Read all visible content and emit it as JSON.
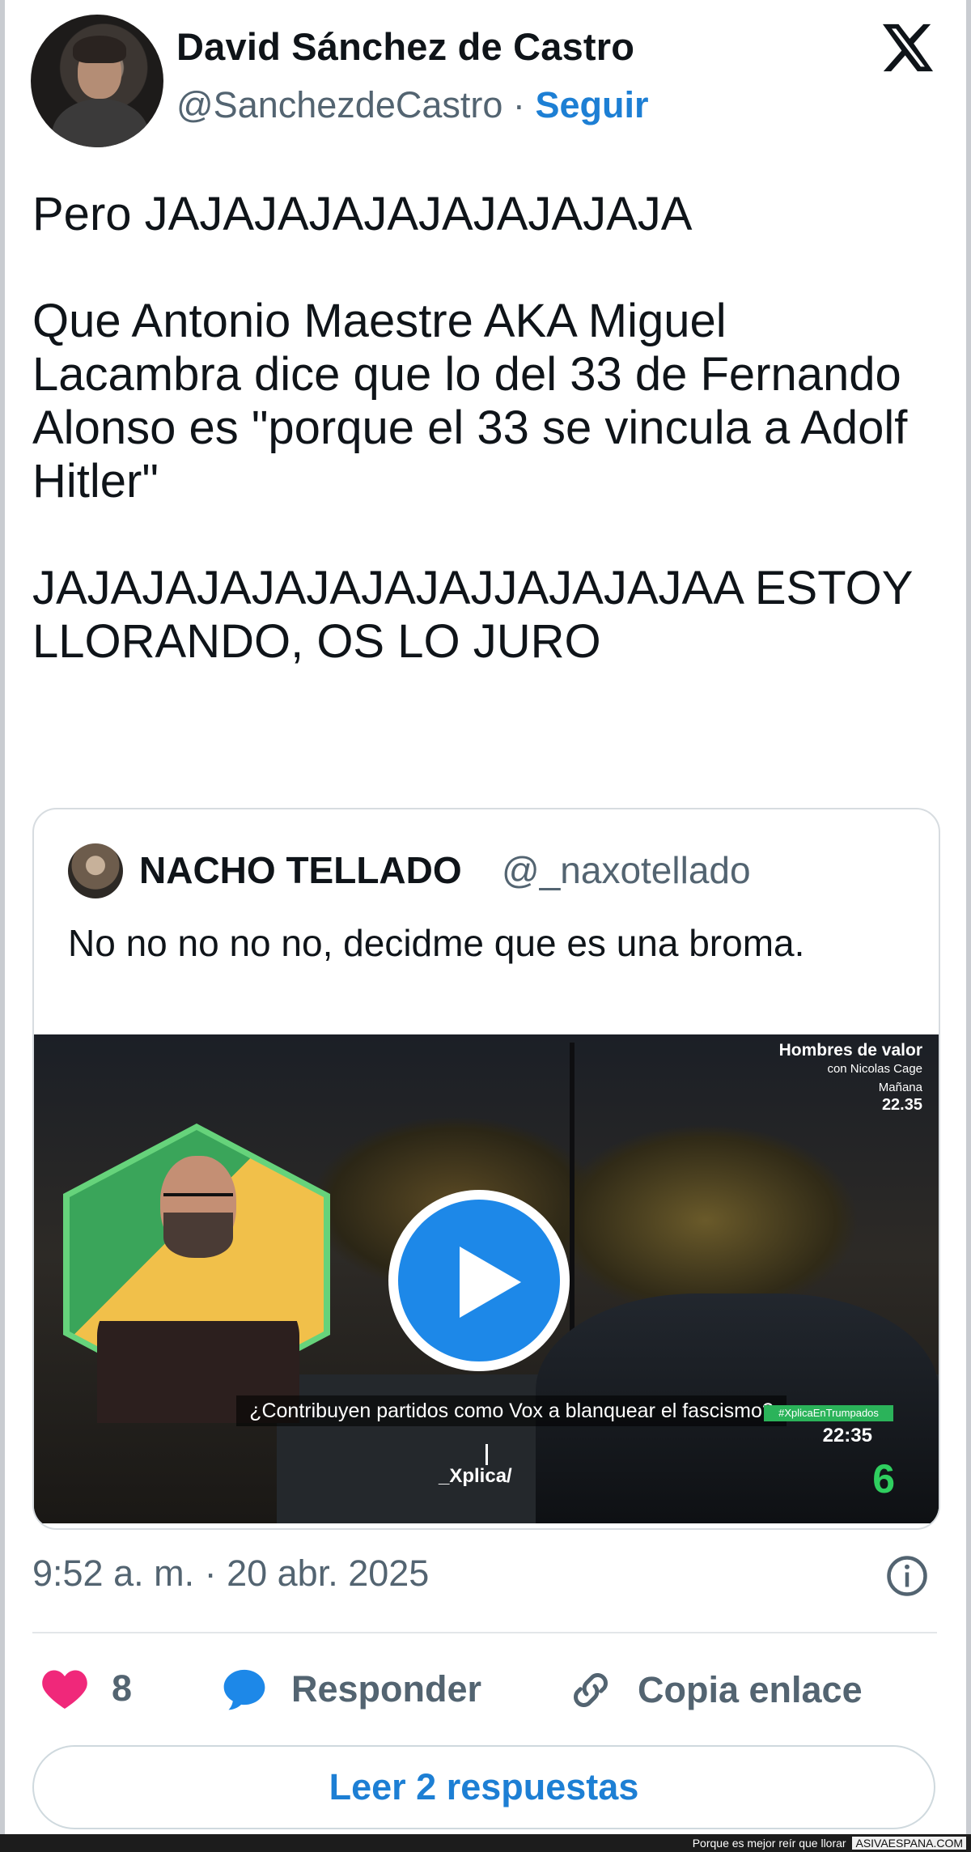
{
  "author": {
    "name": "David Sánchez de Castro",
    "handle": "@SanchezdeCastro",
    "separator": "·",
    "follow_label": "Seguir"
  },
  "tweet": {
    "text": "Pero JAJAJAJAJAJAJAJAJAJA\n\nQue Antonio Maestre AKA Miguel Lacambra dice que lo del 33 de Fernando Alonso es \"porque el 33 se vincula a Adolf Hitler\"\n\nJAJAJAJAJAJAJAJAJJAJAJAJAA ESTOY LLORANDO, OS LO JURO"
  },
  "quote": {
    "name": "NACHO TELLADO",
    "handle": "@_naxotellado",
    "text": "No no no no no, decidme que es una broma.",
    "video": {
      "promo_title": "Hombres de valor",
      "promo_sub": "con Nicolas Cage",
      "promo_when": "Mañana",
      "promo_time": "22.35",
      "caption": "¿Contribuyen partidos como Vox a blanquear el fascismo?",
      "brand": "_Xplica/",
      "hashtag": "#XplicaEnTrumpados",
      "clock": "22:35",
      "channel": "6"
    }
  },
  "meta": {
    "timestamp": "9:52 a. m. · 20 abr. 2025"
  },
  "actions": {
    "like_count": "8",
    "reply_label": "Responder",
    "copy_label": "Copia enlace"
  },
  "read_replies_label": "Leer 2 respuestas",
  "footer": {
    "tagline": "Porque es mejor reír que llorar",
    "site": "ASIVAESPANA.COM"
  },
  "colors": {
    "accent": "#1d7fd4",
    "like": "#f0287a",
    "muted": "#536471"
  },
  "icons": [
    "x-logo-icon",
    "info-icon",
    "heart-icon",
    "speech-bubble-icon",
    "link-icon",
    "play-icon"
  ]
}
